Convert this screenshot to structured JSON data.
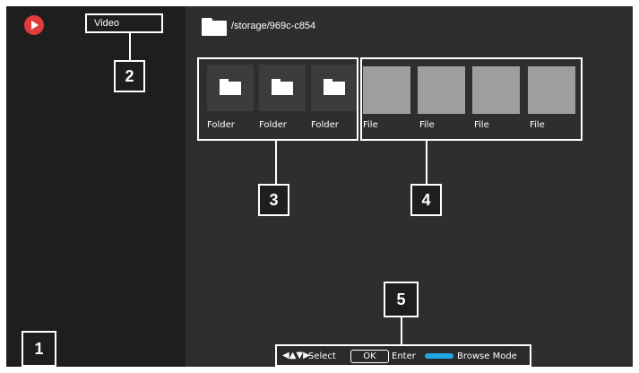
{
  "header": {
    "tab_video": "Video",
    "path": "/storage/969c-c854"
  },
  "tiles": {
    "folders": [
      "Folder",
      "Folder",
      "Folder"
    ],
    "files": [
      "File",
      "File",
      "File",
      "File"
    ]
  },
  "callouts": {
    "n1": "1",
    "n2": "2",
    "n3": "3",
    "n4": "4",
    "n5": "5"
  },
  "footer": {
    "arrows": "◀▲▼▶",
    "select": "Select",
    "ok": "OK",
    "enter": "Enter",
    "browse_mode": "Browse Mode"
  },
  "colors": {
    "app_icon": "#e23b3b",
    "browse_mode_pill": "#1fa7e6"
  }
}
